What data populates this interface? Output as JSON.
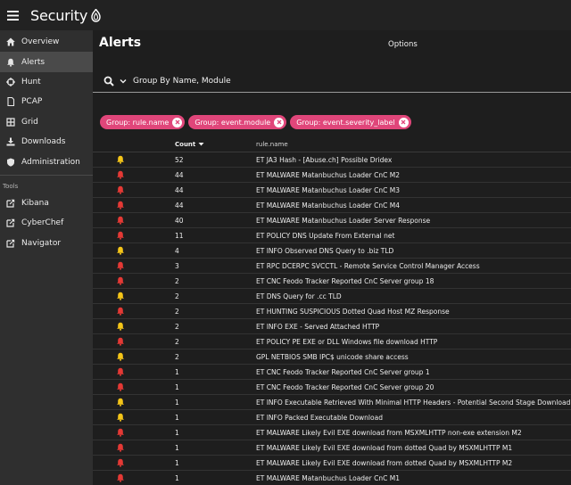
{
  "app": {
    "brand_text": "Security",
    "brand_mark": "onion-logo"
  },
  "sidebar": {
    "items": [
      {
        "label": "Overview",
        "icon": "home-icon",
        "active": false
      },
      {
        "label": "Alerts",
        "icon": "bell-icon",
        "active": true
      },
      {
        "label": "Hunt",
        "icon": "crosshairs-icon",
        "active": false
      },
      {
        "label": "PCAP",
        "icon": "file-icon",
        "active": false
      },
      {
        "label": "Grid",
        "icon": "grid-icon",
        "active": false
      },
      {
        "label": "Downloads",
        "icon": "download-icon",
        "active": false
      },
      {
        "label": "Administration",
        "icon": "shield-icon",
        "active": false
      }
    ],
    "tools_label": "Tools",
    "tools": [
      {
        "label": "Kibana",
        "icon": "external-link-icon"
      },
      {
        "label": "CyberChef",
        "icon": "external-link-icon"
      },
      {
        "label": "Navigator",
        "icon": "external-link-icon"
      }
    ]
  },
  "main": {
    "title": "Alerts",
    "options_label": "Options",
    "query": "Group By Name, Module",
    "chips": [
      "Group: rule.name",
      "Group: event.module",
      "Group: event.severity_label"
    ],
    "table": {
      "headers": {
        "count": "Count",
        "name": "rule.name"
      },
      "rows": [
        {
          "severity": "medium",
          "count": "52",
          "name": "ET JA3 Hash - [Abuse.ch] Possible Dridex"
        },
        {
          "severity": "high",
          "count": "44",
          "name": "ET MALWARE Matanbuchus Loader CnC M2"
        },
        {
          "severity": "high",
          "count": "44",
          "name": "ET MALWARE Matanbuchus Loader CnC M3"
        },
        {
          "severity": "high",
          "count": "44",
          "name": "ET MALWARE Matanbuchus Loader CnC M4"
        },
        {
          "severity": "high",
          "count": "40",
          "name": "ET MALWARE Matanbuchus Loader Server Response"
        },
        {
          "severity": "high",
          "count": "11",
          "name": "ET POLICY DNS Update From External net"
        },
        {
          "severity": "medium",
          "count": "4",
          "name": "ET INFO Observed DNS Query to .biz TLD"
        },
        {
          "severity": "high",
          "count": "3",
          "name": "ET RPC DCERPC SVCCTL - Remote Service Control Manager Access"
        },
        {
          "severity": "high",
          "count": "2",
          "name": "ET CNC Feodo Tracker Reported CnC Server group 18"
        },
        {
          "severity": "medium",
          "count": "2",
          "name": "ET DNS Query for .cc TLD"
        },
        {
          "severity": "high",
          "count": "2",
          "name": "ET HUNTING SUSPICIOUS Dotted Quad Host MZ Response"
        },
        {
          "severity": "medium",
          "count": "2",
          "name": "ET INFO EXE - Served Attached HTTP"
        },
        {
          "severity": "high",
          "count": "2",
          "name": "ET POLICY PE EXE or DLL Windows file download HTTP"
        },
        {
          "severity": "medium",
          "count": "2",
          "name": "GPL NETBIOS SMB IPC$ unicode share access"
        },
        {
          "severity": "high",
          "count": "1",
          "name": "ET CNC Feodo Tracker Reported CnC Server group 1"
        },
        {
          "severity": "high",
          "count": "1",
          "name": "ET CNC Feodo Tracker Reported CnC Server group 20"
        },
        {
          "severity": "medium",
          "count": "1",
          "name": "ET INFO Executable Retrieved With Minimal HTTP Headers - Potential Second Stage Download"
        },
        {
          "severity": "medium",
          "count": "1",
          "name": "ET INFO Packed Executable Download"
        },
        {
          "severity": "high",
          "count": "1",
          "name": "ET MALWARE Likely Evil EXE download from MSXMLHTTP non-exe extension M2"
        },
        {
          "severity": "high",
          "count": "1",
          "name": "ET MALWARE Likely Evil EXE download from dotted Quad by MSXMLHTTP M1"
        },
        {
          "severity": "high",
          "count": "1",
          "name": "ET MALWARE Likely Evil EXE download from dotted Quad by MSXMLHTTP M2"
        },
        {
          "severity": "high",
          "count": "1",
          "name": "ET MALWARE Matanbuchus Loader CnC M1"
        }
      ]
    }
  },
  "colors": {
    "chip": "#e0467a",
    "severity_high": "#e53935",
    "severity_medium": "#f5c518",
    "sidebar_bg": "#2f2f2f",
    "main_bg": "#1e1e1e"
  }
}
